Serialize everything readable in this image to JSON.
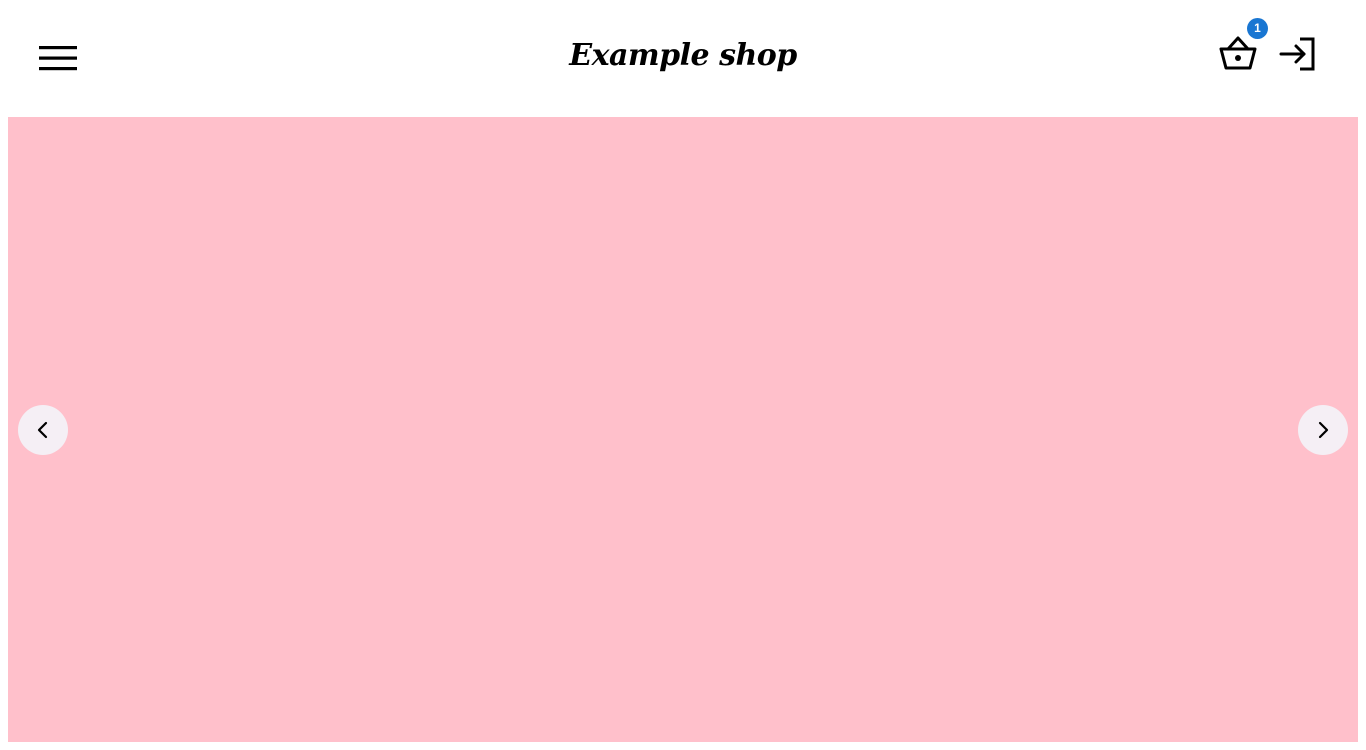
{
  "header": {
    "logo_text": "Example shop",
    "basket": {
      "count": "1",
      "badge_color": "#1976d2"
    },
    "icons": {
      "menu": "hamburger-menu-icon",
      "basket": "shopping-basket-icon",
      "login": "login-icon"
    }
  },
  "carousel": {
    "background_color": "#ffc0cb",
    "icons": {
      "prev": "chevron-left-icon",
      "next": "chevron-right-icon"
    }
  }
}
